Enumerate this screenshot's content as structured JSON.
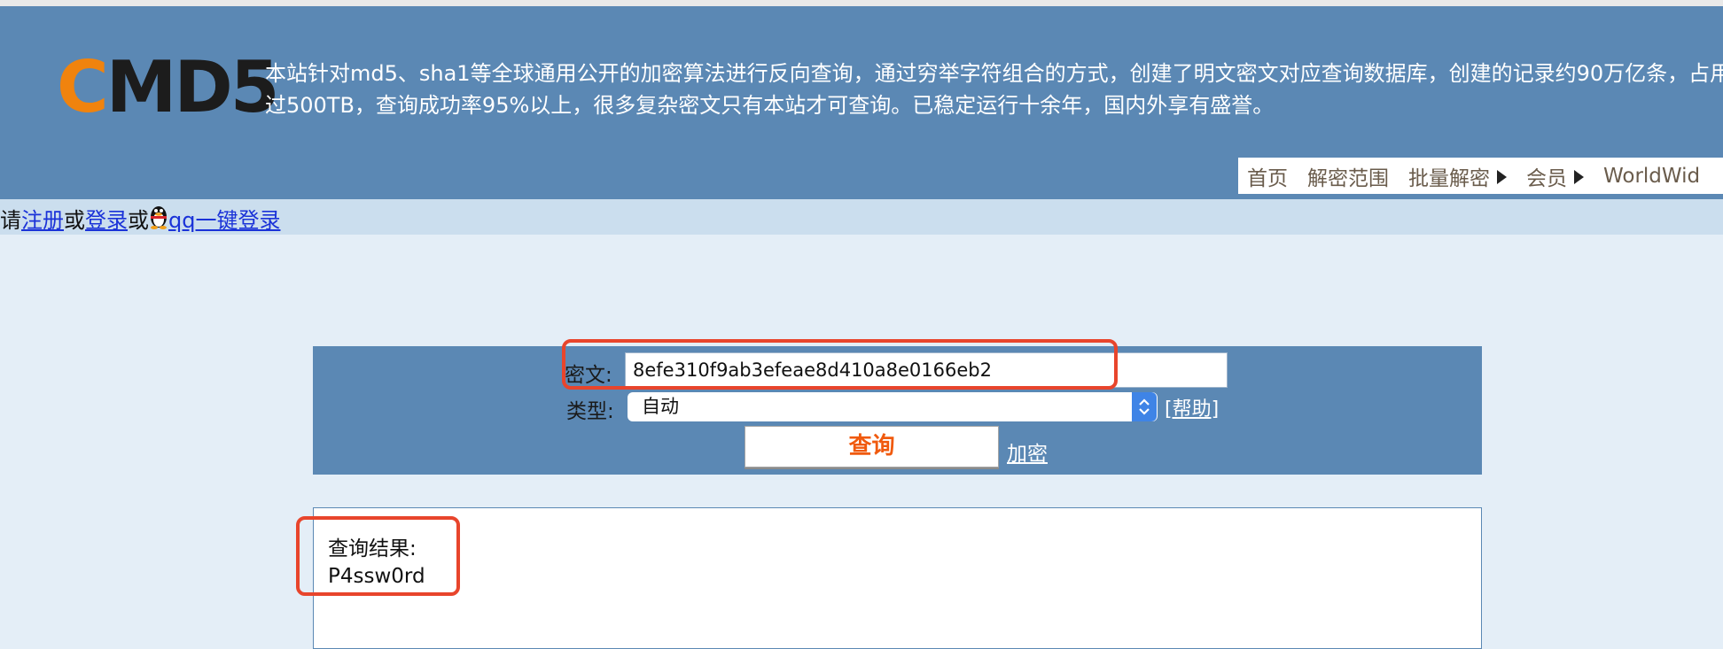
{
  "header": {
    "logo_c": "C",
    "logo_rest": "MD5",
    "intro_line1": "本站针对md5、sha1等全球通用公开的加密算法进行反向查询，通过穷举字符组合的方式，创建了明文密文对应查询数据库，创建的记录约90万亿条，占用",
    "intro_line2": "过500TB，查询成功率95%以上，很多复杂密文只有本站才可查询。已稳定运行十余年，国内外享有盛誉。"
  },
  "nav": {
    "items": [
      {
        "label": "首页",
        "has_arrow": false
      },
      {
        "label": "解密范围",
        "has_arrow": false
      },
      {
        "label": "批量解密",
        "has_arrow": true
      },
      {
        "label": "会员",
        "has_arrow": true
      },
      {
        "label": "WorldWid",
        "has_arrow": false
      }
    ]
  },
  "login_bar": {
    "prefix": "请",
    "register": "注册",
    "or1": "或",
    "login": "登录",
    "or2": "或",
    "qq_login": "qq一键登录"
  },
  "form": {
    "cipher_label": "密文:",
    "cipher_value": "8efe310f9ab3efeae8d410a8e0166eb2",
    "type_label": "类型:",
    "type_value": "自动",
    "help": "[帮助]",
    "query_button": "查询",
    "encrypt_link": "加密"
  },
  "result": {
    "label": "查询结果:",
    "value": "P4ssw0rd"
  },
  "colors": {
    "header_bg": "#5b88b4",
    "accent_orange": "#f05a0e",
    "highlight_red": "#e8452c",
    "link_blue": "#1a32d8"
  }
}
